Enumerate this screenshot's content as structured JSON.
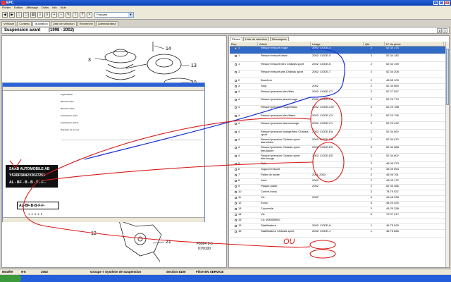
{
  "window": {
    "title": "EPC"
  },
  "menu": [
    "Fichier",
    "Edition",
    "Affichage",
    "Outils",
    "Info",
    "Aide"
  ],
  "toolbar": {
    "language": "Français"
  },
  "main_tabs": [
    "Véhicule",
    "Contenu",
    "Illustration",
    "Liste de sélection",
    "Recherche",
    "Administrateur"
  ],
  "header": {
    "title": "Suspension avant",
    "years": "(1998 - 2002)"
  },
  "illustration": {
    "callouts": [
      "3",
      "14",
      "13",
      "10",
      "12",
      "21"
    ],
    "figure_code": "F8664 9-5",
    "figure_date": "07/0100"
  },
  "vin_plate": {
    "line1": "SAAB AUTOMOBILE AB",
    "line2": "YS3DF58N2V2027251",
    "code": "AL - BF - B - B - F - F -",
    "code_enlarged": "AL-BF-B-B-F-F-",
    "positions": "1  2  3  4  5"
  },
  "inner_window": {
    "items": [
      "Angle latéral",
      "Ressort avant",
      "Ressort arrière",
      "Amortisseur avant",
      "Amortisseur arrière",
      "Diamètre de la roue"
    ]
  },
  "parts_tabs": [
    "Pièces",
    "Liste de sélection",
    "Remarques"
  ],
  "table": {
    "headers": {
      "rep": "Rep.",
      "article": "Article",
      "usage": "Usage",
      "qte": "Qté",
      "pn": "N° de pièce"
    },
    "rows": [
      {
        "rep": "1",
        "article": "Ressort ressort rouge",
        "usage": "2002: CODE-4",
        "qte": "2",
        "pn": "52 34 174"
      },
      {
        "rep": "1",
        "article": "Ressort ressort blanc",
        "usage": "2002: CODE-5",
        "qte": "2",
        "pn": "52 34 182"
      },
      {
        "rep": "1",
        "article": "Ressort ressort bleu Châssis sport",
        "usage": "2002: CODE-6",
        "qte": "2",
        "pn": "52 34 190"
      },
      {
        "rep": "1",
        "article": "Ressort ressort gris Châssis sport",
        "usage": "2002: CODE-7",
        "qte": "2",
        "pn": "52 34 208"
      },
      {
        "rep": "2",
        "article": "Bouchon",
        "usage": "",
        "qte": "2",
        "pn": "45 65 109"
      },
      {
        "rep": "3",
        "article": "Stop",
        "usage": "2002",
        "qte": "2",
        "pn": "52 34 869"
      },
      {
        "rep": "4",
        "article": "Ressort pression bleu/bleu",
        "usage": "2002: CODE-C7",
        "qte": "2",
        "pn": "52 27 557"
      },
      {
        "rep": "4",
        "article": "Ressort pression jaune/rouge",
        "usage": "2002: CODE-C8",
        "qte": "2",
        "pn": "52 23 770"
      },
      {
        "rep": "4",
        "article": "Ressort pression rouge/blanc",
        "usage": "2002: CODE-CW",
        "qte": "2",
        "pn": "52 23 788"
      },
      {
        "rep": "4",
        "article": "Ressort pression bleu/blanc",
        "usage": "2002: CODE-CX",
        "qte": "2",
        "pn": "52 23 796"
      },
      {
        "rep": "4",
        "article": "Ressort pression blanc/orange",
        "usage": "2002: CODE-CY",
        "qte": "2",
        "pn": "52 23 432"
      },
      {
        "rep": "4",
        "article": "Ressort pression orange/bleu Châssis sport",
        "usage": "2002: CODE-EA",
        "qte": "2",
        "pn": "52 34 562"
      },
      {
        "rep": "4",
        "article": "Ressort pression Châssis sport blanc/bleu",
        "usage": "2002: CODE-EB",
        "qte": "2",
        "pn": "52 34 570"
      },
      {
        "rep": "4",
        "article": "Ressort pression Châssis sport bleu/jaune",
        "usage": "2002: CODE-EC",
        "qte": "2",
        "pn": "52 34 588"
      },
      {
        "rep": "4",
        "article": "Ressort pression Châssis sport bleu/rouge",
        "usage": "2002: CODE-ED",
        "qte": "2",
        "pn": "52 34 802"
      },
      {
        "rep": "5",
        "article": "Cale",
        "usage": "",
        "qte": "2",
        "pn": "46 09 373"
      },
      {
        "rep": "6",
        "article": "Support ressort",
        "usage": "",
        "qte": "2",
        "pn": "46 09 553"
      },
      {
        "rep": "7",
        "article": "Palier de butée",
        "usage": "2001-2002",
        "qte": "2",
        "pn": "46 09 761"
      },
      {
        "rep": "8",
        "article": "Joint",
        "usage": "2002",
        "qte": "2",
        "pn": "45 05 172"
      },
      {
        "rep": "9",
        "article": "Plaque-palier",
        "usage": "2002",
        "qte": "2",
        "pn": "52 33 366"
      },
      {
        "rep": "10",
        "article": "Contre-écrou",
        "usage": "",
        "qte": "2",
        "pn": "78 79 537"
      },
      {
        "rep": "11",
        "article": "Vis",
        "usage": "2002",
        "qte": "6",
        "pn": "43 48 538"
      },
      {
        "rep": "12",
        "article": "Ecrou",
        "usage": "",
        "qte": "4",
        "pn": "46 24 020"
      },
      {
        "rep": "13",
        "article": "Couvercle",
        "usage": "",
        "qte": "2",
        "pn": "45 20 338"
      },
      {
        "rep": "14",
        "article": "Vis",
        "usage": "",
        "qte": "6",
        "pn": "79 07 217"
      },
      {
        "rep": "15",
        "article": "Ch: W3055960-",
        "usage": "",
        "qte": "",
        "pn": ""
      },
      {
        "rep": "15",
        "article": "Stabilisateur",
        "usage": "2002: CODE-H",
        "qte": "1",
        "pn": "46 75 625"
      },
      {
        "rep": "15",
        "article": "Stabilisateur Châssis sport",
        "usage": "2002: CODE-J",
        "qte": "1",
        "pn": "46 75 666"
      }
    ]
  },
  "annotation": {
    "label": "OU"
  },
  "status": {
    "model_label": "Modèle",
    "model": "9-5",
    "year": "2002",
    "group": "Groupe 7 Système de suspension",
    "section": "Section 8100",
    "filter": "Filtre EN SERVICE"
  }
}
